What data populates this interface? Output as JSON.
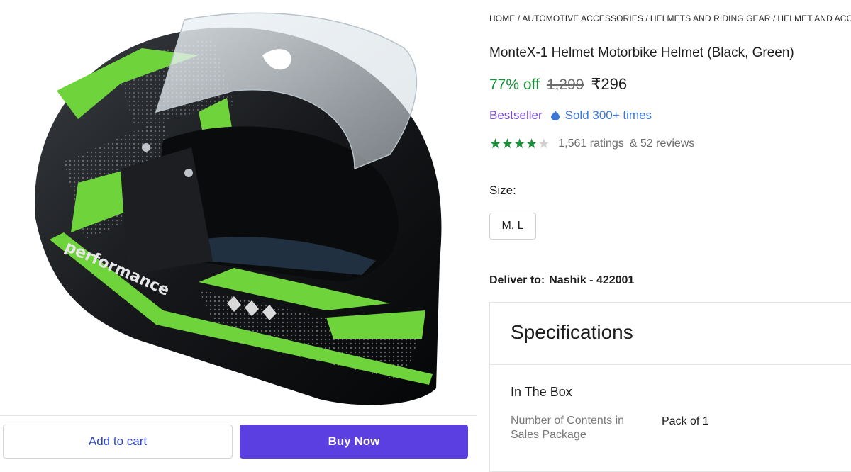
{
  "breadcrumb": [
    "HOME /",
    "AUTOMOTIVE ACCESSORIES /",
    "HELMETS AND RIDING GEAR /",
    "HELMET AND ACCE"
  ],
  "product": {
    "title": "MonteX-1 Helmet Motorbike Helmet (Black, Green)",
    "discount": "77% off",
    "mrp": "1,299",
    "price": "₹296",
    "badge": "Bestseller",
    "sold": "Sold 300+ times",
    "rating_value": 4,
    "rating_max": 5,
    "ratings_count": "1,561 ratings",
    "reviews_count": "& 52 reviews"
  },
  "size": {
    "label": "Size:",
    "option": "M, L"
  },
  "delivery": {
    "label": "Deliver to:",
    "location": "Nashik - 422001"
  },
  "specifications": {
    "title": "Specifications",
    "section": "In The Box",
    "key": "Number of Contents in Sales Package",
    "value": "Pack of 1"
  },
  "actions": {
    "add_to_cart": "Add to cart",
    "buy_now": "Buy Now"
  },
  "image": {
    "decal_text": "performance"
  },
  "colors": {
    "accent_purple": "#5b3fe0",
    "discount_green": "#1b8f3a",
    "helmet_green": "#6fd33c",
    "bestseller_purple": "#7a4fd6",
    "sold_blue": "#3d78d8"
  },
  "icons": [
    "helmet-product-image",
    "sold-flame-icon",
    "star-icon"
  ]
}
